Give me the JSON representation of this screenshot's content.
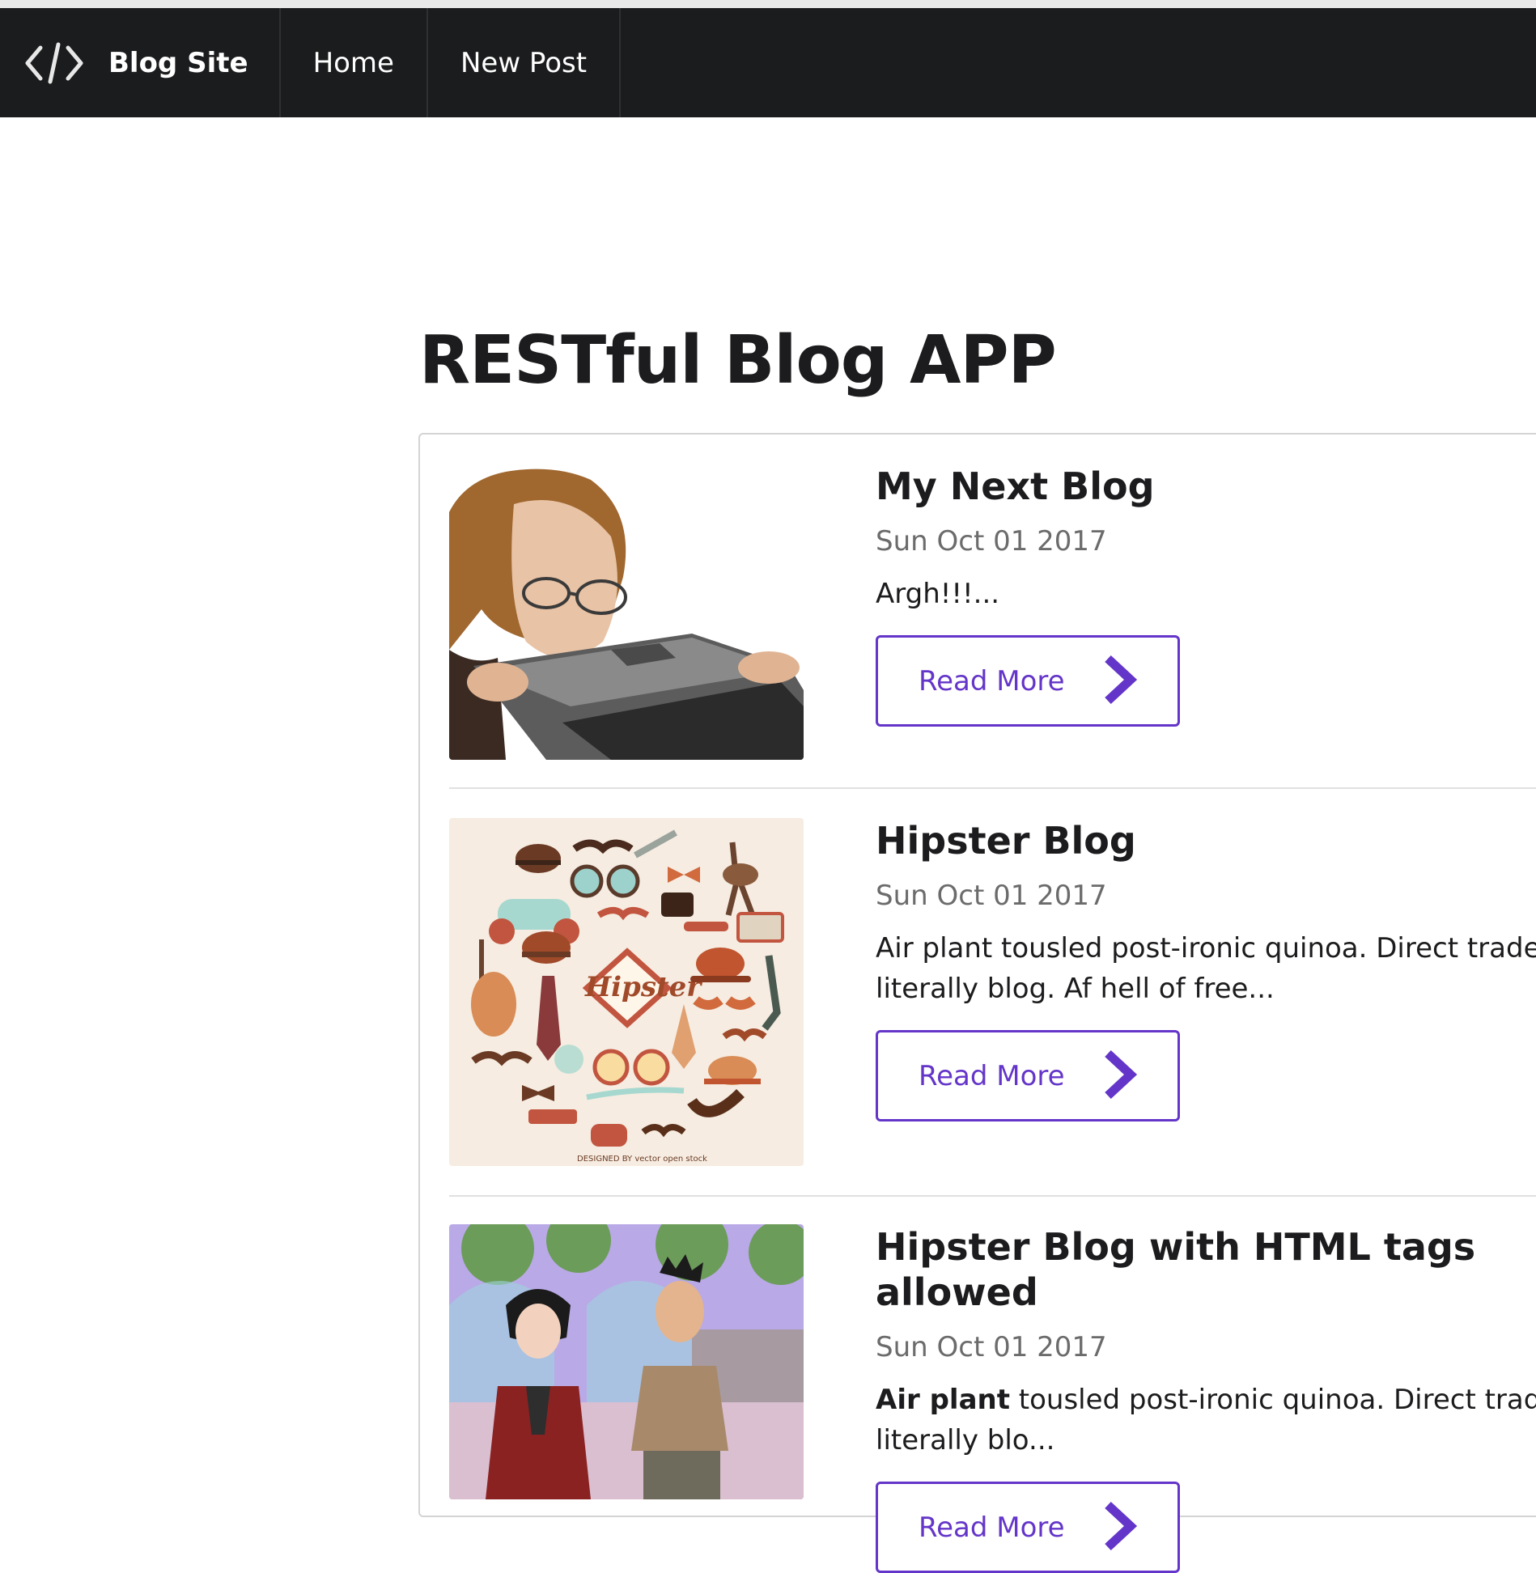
{
  "navbar": {
    "brand_label": "Blog Site",
    "home_label": "Home",
    "new_post_label": "New Post",
    "brand_icon": "code-icon"
  },
  "page": {
    "title": "RESTful Blog APP"
  },
  "colors": {
    "navbar_bg": "#1b1c1d",
    "accent": "#6435c9"
  },
  "posts": [
    {
      "title": "My Next Blog",
      "date": "Sun Oct 01 2017",
      "excerpt": "Argh!!!...",
      "read_more_label": "Read More"
    },
    {
      "title": "Hipster Blog",
      "date": "Sun Oct 01 2017",
      "excerpt": "Air plant tousled post-ironic quinoa. Direct trade literally blog. Af hell of free...",
      "read_more_label": "Read More",
      "image_text": "Hipster",
      "image_credit": "DESIGNED BY vector open stock"
    },
    {
      "title": "Hipster Blog with HTML tags allowed",
      "date": "Sun Oct 01 2017",
      "excerpt_bold": "Air plant",
      "excerpt_rest": " tousled post-ironic quinoa. Direct trade literally blo...",
      "read_more_label": "Read More"
    }
  ]
}
